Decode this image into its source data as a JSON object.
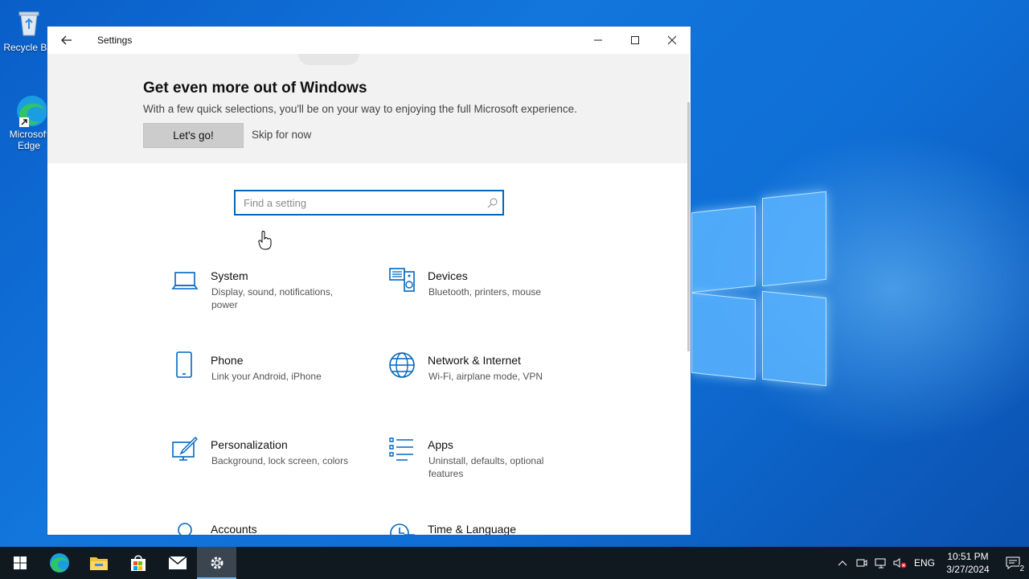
{
  "desktop": {
    "icons": [
      {
        "label": "Recycle Bin"
      },
      {
        "label": "Microsoft Edge"
      }
    ]
  },
  "window": {
    "title": "Settings",
    "controls": {
      "minimize": "—",
      "maximize": "☐",
      "close": "✕"
    }
  },
  "promo": {
    "title": "Get even more out of Windows",
    "subtitle": "With a few quick selections, you'll be on your way to enjoying the full Microsoft experience.",
    "primary_label": "Let's go!",
    "secondary_label": "Skip for now"
  },
  "search": {
    "placeholder": "Find a setting",
    "value": ""
  },
  "categories": [
    {
      "name": "System",
      "desc": "Display, sound, notifications, power",
      "icon": "laptop-icon"
    },
    {
      "name": "Devices",
      "desc": "Bluetooth, printers, mouse",
      "icon": "devices-icon"
    },
    {
      "name": "Phone",
      "desc": "Link your Android, iPhone",
      "icon": "phone-icon"
    },
    {
      "name": "Network & Internet",
      "desc": "Wi-Fi, airplane mode, VPN",
      "icon": "globe-icon"
    },
    {
      "name": "Personalization",
      "desc": "Background, lock screen, colors",
      "icon": "paintbrush-icon"
    },
    {
      "name": "Apps",
      "desc": "Uninstall, defaults, optional features",
      "icon": "apps-list-icon"
    },
    {
      "name": "Accounts",
      "desc": "",
      "icon": "person-icon"
    },
    {
      "name": "Time & Language",
      "desc": "",
      "icon": "clock-language-icon"
    }
  ],
  "taskbar": {
    "apps": [
      "start-icon",
      "edge-icon",
      "file-explorer-icon",
      "store-icon",
      "mail-icon",
      "settings-gear-icon"
    ],
    "tray": {
      "language": "ENG",
      "time": "10:51 PM",
      "date": "3/27/2024",
      "notification_count": "2"
    }
  },
  "colors": {
    "accent": "#0067c0",
    "taskbar": "#101820",
    "promo_bg": "#f2f2f2"
  }
}
